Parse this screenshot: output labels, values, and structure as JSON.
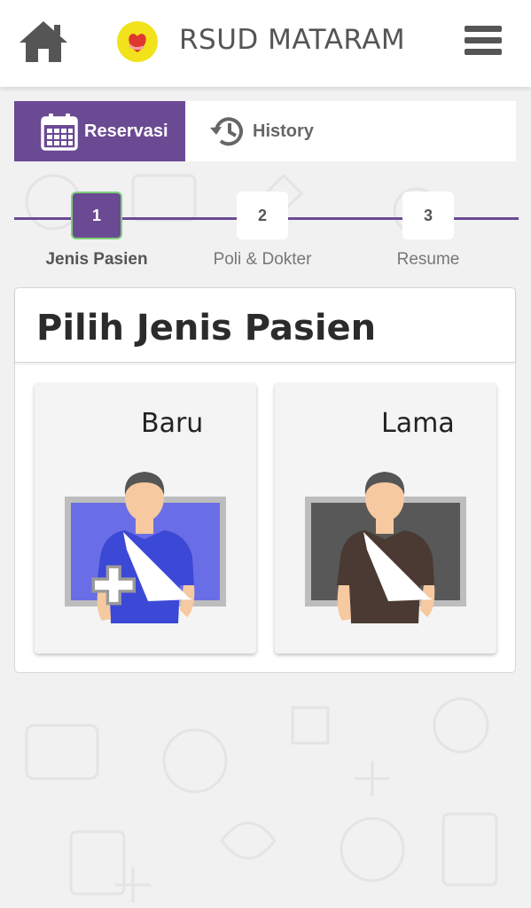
{
  "header": {
    "title": "RSUD MATARAM",
    "home_icon": "home-icon",
    "logo": "hospital-logo",
    "menu_icon": "hamburger-menu-icon"
  },
  "tabs": [
    {
      "label": "Reservasi",
      "icon": "calendar-icon",
      "active": true
    },
    {
      "label": "History",
      "icon": "history-icon",
      "active": false
    }
  ],
  "stepper": {
    "steps": [
      {
        "number": "1",
        "label": "Jenis Pasien",
        "active": true
      },
      {
        "number": "2",
        "label": "Poli & Dokter",
        "active": false
      },
      {
        "number": "3",
        "label": "Resume",
        "active": false
      }
    ]
  },
  "card": {
    "title": "Pilih Jenis Pasien",
    "options": [
      {
        "label": "Baru",
        "icon": "new-patient-icon",
        "color": "#6a6ee6"
      },
      {
        "label": "Lama",
        "icon": "existing-patient-icon",
        "color": "#585858"
      }
    ]
  },
  "colors": {
    "accent": "#6b4a94",
    "active_border": "#7fd07a",
    "background": "#f1f1f1"
  }
}
